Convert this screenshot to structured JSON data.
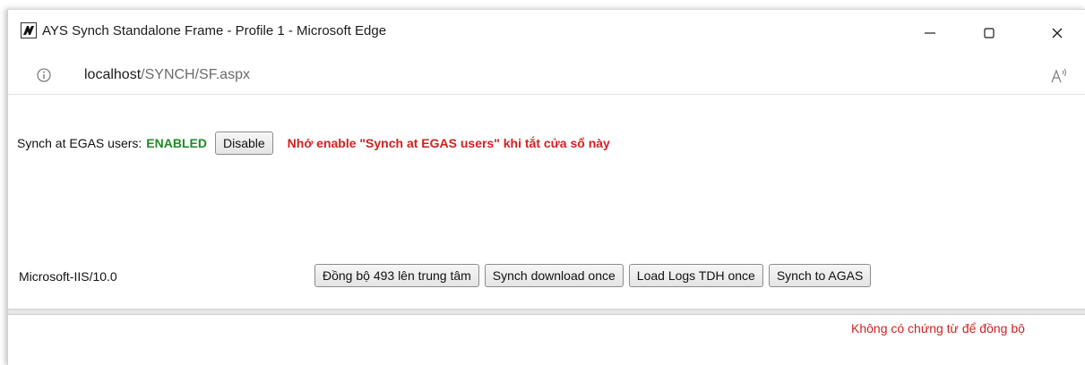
{
  "window": {
    "title": "AYS Synch Standalone Frame - Profile 1 - Microsoft Edge",
    "logo_icon": "ays-logo-icon",
    "controls": [
      "minimize-icon",
      "maximize-icon",
      "close-icon"
    ]
  },
  "address_bar": {
    "icon": "info-icon",
    "url_host": "localhost",
    "url_path": "/SYNCH/SF.aspx",
    "right_icon": "read-aloud-icon"
  },
  "synch": {
    "label": "Synch at EGAS users:",
    "status": "ENABLED",
    "status_color": "#1e8b24",
    "disable_label": "Disable",
    "reminder": "Nhớ enable \"Synch at EGAS users\" khi tắt cửa sổ này",
    "reminder_color": "#d32020"
  },
  "footer": {
    "server": "Microsoft-IIS/10.0",
    "buttons": [
      "Đồng bộ 493 lên trung tâm",
      "Synch download once",
      "Load Logs TDH once",
      "Synch to AGAS"
    ]
  },
  "lower_panel": {
    "message": "Không có chứng từ để đồng bộ"
  }
}
